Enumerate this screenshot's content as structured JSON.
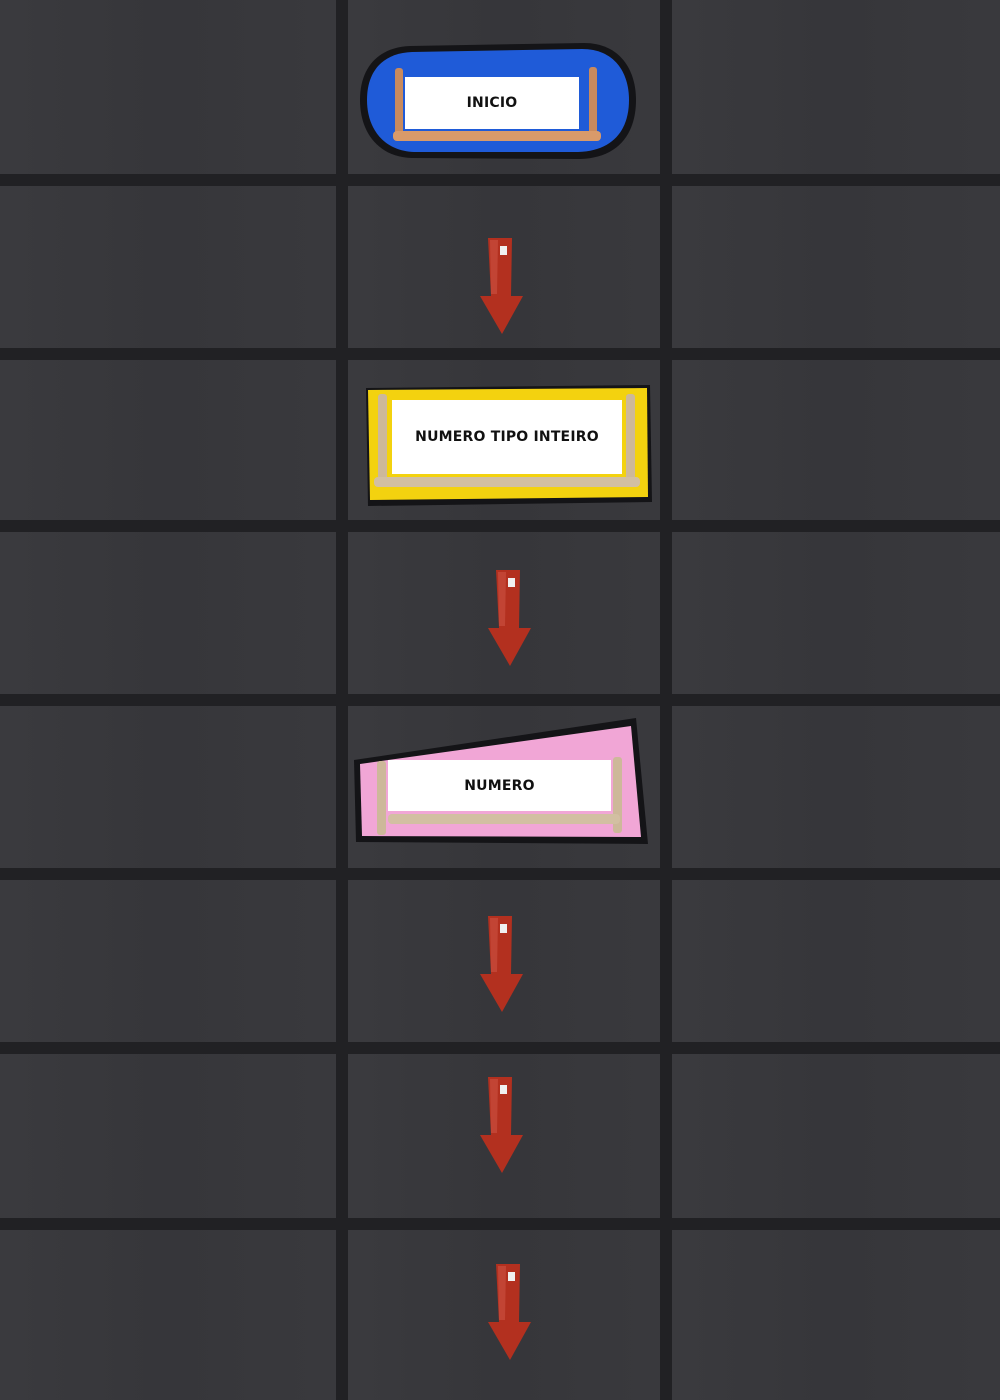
{
  "flowchart": {
    "start": {
      "label": "INICIO",
      "color": "#1f5bd8"
    },
    "declare": {
      "label": "NUMERO TIPO INTEIRO",
      "color": "#f3d20f"
    },
    "input": {
      "label": "NUMERO",
      "color": "#f1a6d6"
    }
  },
  "colors": {
    "background": "#212124",
    "grid_cell": "#37373b",
    "arrow": "#b3301f",
    "stick": "#cdb89a"
  },
  "connectors": [
    {
      "from": "start",
      "to": "declare",
      "icon": "down-arrow-icon"
    },
    {
      "from": "declare",
      "to": "input",
      "icon": "down-arrow-icon"
    },
    {
      "from": "input",
      "to": "",
      "icon": "down-arrow-icon"
    },
    {
      "from": "",
      "to": "",
      "icon": "down-arrow-icon"
    },
    {
      "from": "",
      "to": "",
      "icon": "down-arrow-icon"
    }
  ]
}
